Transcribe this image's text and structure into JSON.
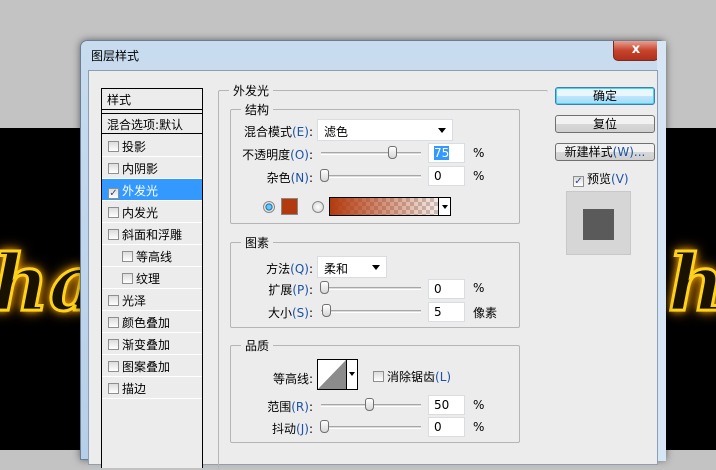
{
  "background": {
    "neon_left": "ha",
    "neon_right": "h"
  },
  "window": {
    "title": "图层样式",
    "close_label": "x"
  },
  "styles": {
    "header": "样式",
    "blending": "混合选项:默认",
    "items": [
      {
        "label": "投影",
        "checked": false
      },
      {
        "label": "内阴影",
        "checked": false
      },
      {
        "label": "外发光",
        "checked": true,
        "selected": true
      },
      {
        "label": "内发光",
        "checked": false
      },
      {
        "label": "斜面和浮雕",
        "checked": false
      },
      {
        "label": "等高线",
        "checked": false,
        "indent": true
      },
      {
        "label": "纹理",
        "checked": false,
        "indent": true
      },
      {
        "label": "光泽",
        "checked": false
      },
      {
        "label": "颜色叠加",
        "checked": false
      },
      {
        "label": "渐变叠加",
        "checked": false
      },
      {
        "label": "图案叠加",
        "checked": false
      },
      {
        "label": "描边",
        "checked": false
      }
    ]
  },
  "panel": {
    "title": "外发光",
    "structure": {
      "title": "结构",
      "blend_label": "混合模式",
      "blend_key": "(E)",
      "blend_value": "滤色",
      "opacity_label": "不透明度",
      "opacity_key": "(O)",
      "opacity_value": "75",
      "opacity_unit": "%",
      "opacity_pct": 75,
      "noise_label": "杂色",
      "noise_key": "(N)",
      "noise_value": "0",
      "noise_unit": "%",
      "noise_pct": 0,
      "color": "#b33a0e"
    },
    "elements": {
      "title": "图素",
      "method_label": "方法",
      "method_key": "(Q)",
      "method_value": "柔和",
      "spread_label": "扩展",
      "spread_key": "(P)",
      "spread_value": "0",
      "spread_unit": "%",
      "spread_pct": 0,
      "size_label": "大小",
      "size_key": "(S)",
      "size_value": "5",
      "size_unit": "像素",
      "size_pct": 2
    },
    "quality": {
      "title": "品质",
      "contour_label": "等高线:",
      "antialias_label": "消除锯齿",
      "antialias_key": "(L)",
      "antialias_checked": false,
      "range_label": "范围",
      "range_key": "(R)",
      "range_value": "50",
      "range_unit": "%",
      "range_pct": 50,
      "jitter_label": "抖动",
      "jitter_key": "(J)",
      "jitter_value": "0",
      "jitter_unit": "%",
      "jitter_pct": 0
    }
  },
  "buttons": {
    "ok": "确定",
    "reset": "复位",
    "new_style": "新建样式",
    "new_style_key": "(W)...",
    "preview_label": "预览",
    "preview_key": "(V)",
    "preview_checked": true
  }
}
